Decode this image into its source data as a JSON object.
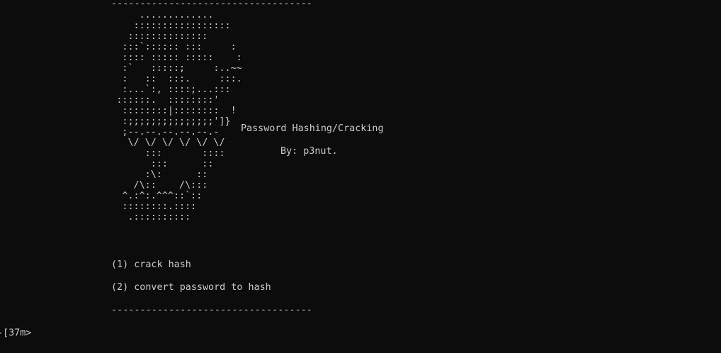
{
  "separator_top": "-----------------------------------",
  "ascii_art": "          .............\n         :::::::::::::::::\n        ::::::::::::::\n       :::`:::::: :::     :\n       :::: ::::: :::::    :\n       :`   :::::;     :..~~\n       :   ::  :::.     :::.\n       :...`:, ::::;...:::\n      ::::::.  ::::::::'\n       ::::::::|::::::::  !\n       :;;;;;;;;;;;;;;;']}\n       ;--.--.--.--.--.-\n        \\/ \\/ \\/ \\/ \\/ \\/\n           :::       ::::\n            :::      ::\n           :\\:      ::\n         /\\::    /\\:::\n       ^.:^:.^^^::`::\n       ::::::::.::::\n        .::::::::::",
  "title": "Password Hashing/Cracking",
  "byline": "By: p3nut.",
  "menu": {
    "option_1": "(1) crack hash",
    "option_2": "(2) convert password to hash"
  },
  "separator_bottom": "-----------------------------------",
  "prompt": "-[37m>",
  "colors": {
    "background": "#0c0c0c",
    "text": "#cccccc"
  }
}
